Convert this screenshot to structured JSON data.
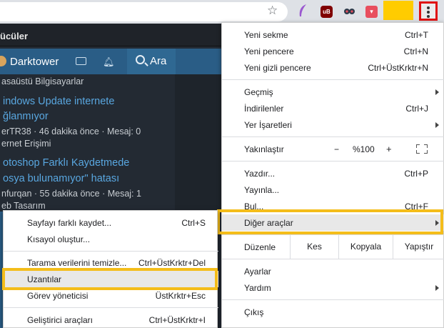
{
  "forum": {
    "section_title": "ücüler",
    "username": "Darktower",
    "search_label": "Ara",
    "threads": [
      {
        "category": "asaüstü Bilgisayarlar"
      },
      {
        "title_line1": "indows Update internete",
        "title_line2": "ğlanmıyor",
        "meta": "erTR38 · 46 dakika önce · Mesaj: 0",
        "category": "ernet Erişimi"
      },
      {
        "title_line1": "otoshop Farklı Kaydetmede",
        "title_line2": "osya bulunamıyor\" hatası",
        "meta": "nfurqan · 55 dakika önce · Mesaj: 1",
        "category": "eb Tasarım"
      }
    ]
  },
  "menu": {
    "new_tab": {
      "label": "Yeni sekme",
      "shortcut": "Ctrl+T"
    },
    "new_window": {
      "label": "Yeni pencere",
      "shortcut": "Ctrl+N"
    },
    "new_incognito": {
      "label": "Yeni gizli pencere",
      "shortcut": "Ctrl+ÜstKrktr+N"
    },
    "history": {
      "label": "Geçmiş"
    },
    "downloads": {
      "label": "İndirilenler",
      "shortcut": "Ctrl+J"
    },
    "bookmarks": {
      "label": "Yer İşaretleri"
    },
    "zoom": {
      "label": "Yakınlaştır",
      "minus": "−",
      "value": "%100",
      "plus": "+"
    },
    "print": {
      "label": "Yazdır...",
      "shortcut": "Ctrl+P"
    },
    "cast": {
      "label": "Yayınla..."
    },
    "find": {
      "label": "Bul...",
      "shortcut": "Ctrl+F"
    },
    "more_tools": {
      "label": "Diğer araçlar"
    },
    "edit": {
      "label": "Düzenle",
      "cut": "Kes",
      "copy": "Kopyala",
      "paste": "Yapıştır"
    },
    "settings": {
      "label": "Ayarlar"
    },
    "help": {
      "label": "Yardım"
    },
    "exit": {
      "label": "Çıkış"
    }
  },
  "submenu": {
    "save_page": {
      "label": "Sayfayı farklı kaydet...",
      "shortcut": "Ctrl+S"
    },
    "create_shortcut": {
      "label": "Kısayol oluştur..."
    },
    "clear_data": {
      "label": "Tarama verilerini temizle...",
      "shortcut": "Ctrl+ÜstKrktr+Del"
    },
    "extensions": {
      "label": "Uzantılar"
    },
    "task_manager": {
      "label": "Görev yöneticisi",
      "shortcut": "ÜstKrktr+Esc"
    },
    "dev_tools": {
      "label": "Geliştirici araçları",
      "shortcut": "Ctrl+ÜstKrktr+I"
    }
  },
  "colors": {
    "highlight_border": "#f4bd1a",
    "menu_button_border": "#e01010",
    "forum_link": "#59a7e0",
    "userbar": "#2a5d86"
  },
  "icons": [
    "star-icon",
    "feather-extension-icon",
    "ublock-icon",
    "owl-extension-icon",
    "pocket-icon",
    "kebab-menu-icon",
    "mail-icon",
    "bell-icon",
    "search-icon",
    "fullscreen-icon",
    "submenu-arrow-icon"
  ]
}
